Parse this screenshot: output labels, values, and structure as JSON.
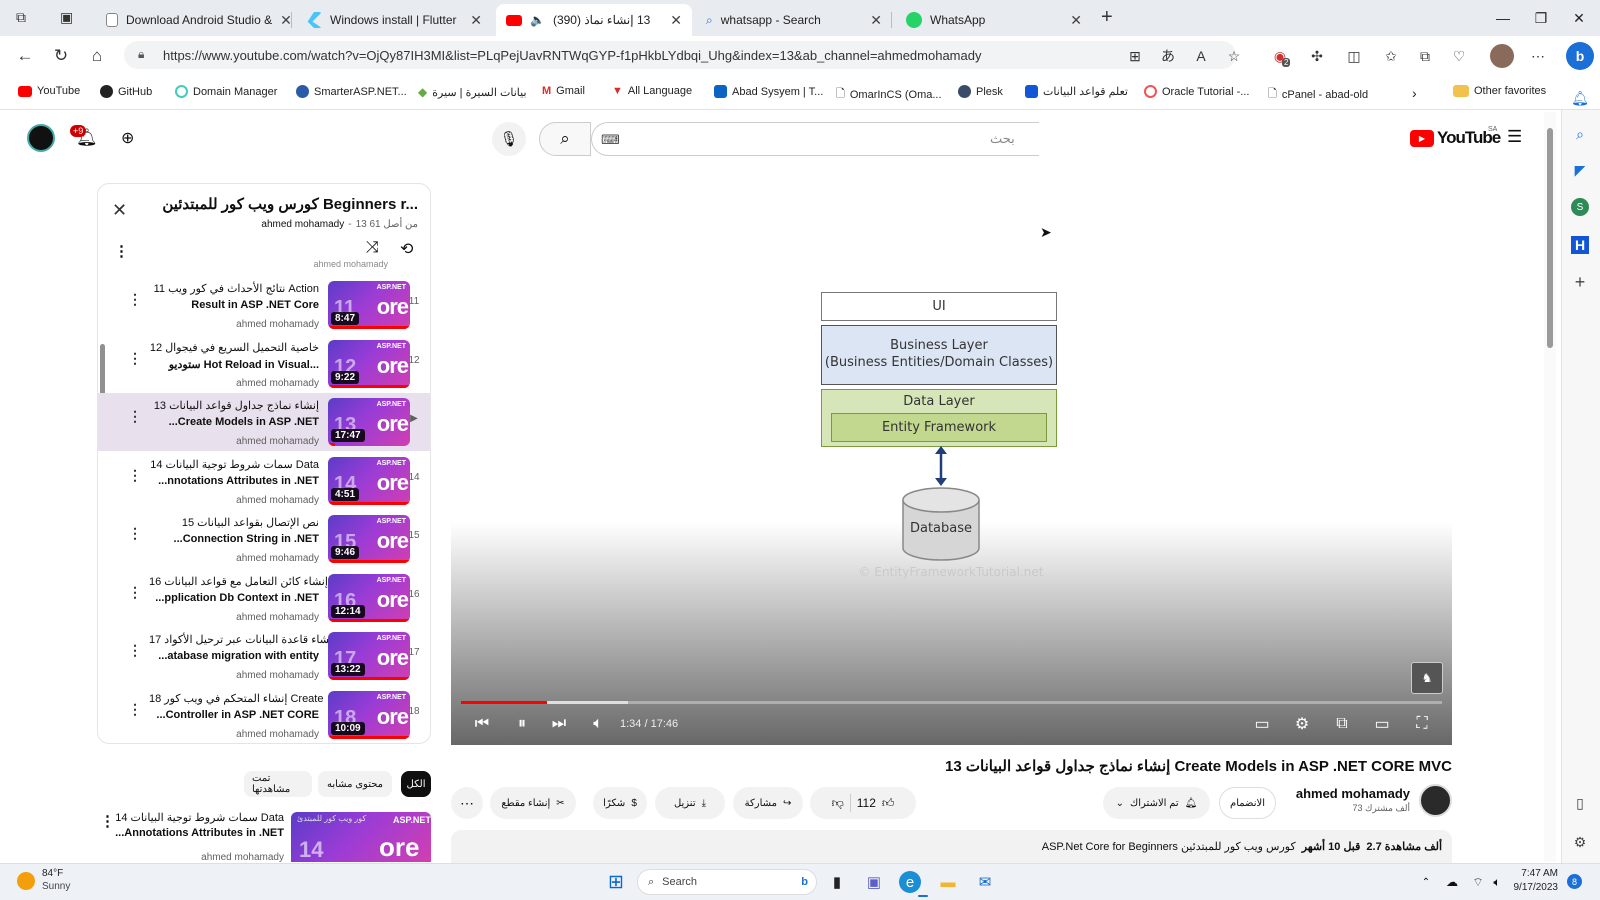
{
  "browser": {
    "tabs": [
      {
        "title": "Download Android Studio &",
        "favicon_color": "#7a7a7a"
      },
      {
        "title": "Windows install | Flutter",
        "favicon_color": "#47c5fb"
      },
      {
        "title": "13 إنشاء نماذ (390)",
        "favicon_color": "#ff0000",
        "active": true
      },
      {
        "title": "whatsapp - Search",
        "favicon_color": "#1a73e8"
      },
      {
        "title": "WhatsApp",
        "favicon_color": "#25d366"
      }
    ],
    "url": "https://www.youtube.com/watch?v=OjQy87IH3MI&list=PLqPejUavRNTWqGYP-f1pHkbLYdbqi_Uhg&index=13&ab_channel=ahmedmohamady",
    "favorites": [
      "YouTube",
      "GitHub",
      "Domain Manager",
      "SmarterASP.NET...",
      "بيانات السيرة | سيرة",
      "Gmail",
      "All Language",
      "Abad Sysyem | T...",
      "OmarInCS (Oma...",
      "Plesk",
      "تعلم قواعد البيانات",
      "Oracle Tutorial -...",
      "cPanel - abad-old"
    ],
    "other_favorites": "Other favorites",
    "ext_badge": "2"
  },
  "youtube": {
    "logo": "YouTube",
    "region": "SA",
    "search_placeholder": "بحث",
    "notif_count": "+9"
  },
  "playlist": {
    "title": "كورس ويب كور للمبتدئين Beginners r...",
    "owner": "ahmed mohamady",
    "position": "13 من أصل 61",
    "items": [
      {
        "idx": "11",
        "line1": "11 نتائج الأحداث في كور ويب Action",
        "line2": "Result in ASP .NET Core",
        "channel": "ahmed mohamady",
        "duration": "8:47",
        "num": "11"
      },
      {
        "idx": "12",
        "line1": "12 خاصية التحميل السريع في فيجوال",
        "line2": "ستوديو Hot Reload in Visual...",
        "channel": "ahmed mohamady",
        "duration": "9:22",
        "num": "12"
      },
      {
        "idx": "▶",
        "line1": "13 إنشاء نماذج جداول قواعد البيانات",
        "line2": "...Create Models in ASP .NET",
        "channel": "ahmed mohamady",
        "duration": "17:47",
        "num": "13"
      },
      {
        "idx": "14",
        "line1": "14 سمات شروط توجية البيانات Data",
        "line2": "...nnotations Attributes in .NET",
        "channel": "ahmed mohamady",
        "duration": "4:51",
        "num": "14"
      },
      {
        "idx": "15",
        "line1": "15 نص الإتصال بقواعد البيانات",
        "line2": "...Connection String in .NET",
        "channel": "ahmed mohamady",
        "duration": "9:46",
        "num": "15"
      },
      {
        "idx": "16",
        "line1": "16 إنشاء كائن التعامل مع قواعد البيانات",
        "line2": "...pplication Db Context in .NET",
        "channel": "ahmed mohamady",
        "duration": "12:14",
        "num": "16"
      },
      {
        "idx": "17",
        "line1": "17 إنشاء قاعدة البيانات عبر ترحيل الأكواد",
        "line2": "...atabase migration with entity",
        "channel": "ahmed mohamady",
        "duration": "13:22",
        "num": "17"
      },
      {
        "idx": "18",
        "line1": "18 إنشاء المتحكم في ويب كور Create",
        "line2": "...Controller in ASP .NET CORE",
        "channel": "ahmed mohamady",
        "duration": "10:09",
        "num": "18"
      }
    ],
    "partial_top_channel": "ahmed mohamady"
  },
  "chips": [
    "الكل",
    "محتوى مشابه",
    "تمت مشاهدتها"
  ],
  "related": {
    "line1": "14 سمات شروط توجية البيانات Data",
    "line2": "...Annotations Attributes in .NET",
    "channel": "ahmed mohamady",
    "thumb_text": "ASP.NET",
    "thumb_core": "ore",
    "thumb_title": "كور ويب كور للمبتدئ",
    "thumb_num": "14"
  },
  "video": {
    "diagram": {
      "ui": "UI",
      "business": "Business Layer",
      "business_sub": "(Business Entities/Domain Classes)",
      "data": "Data Layer",
      "ef": "Entity Framework",
      "db": "Database",
      "watermark": "© EntityFrameworkTutorial.net"
    },
    "time": "1:34 / 17:46",
    "progress": 0.088,
    "buffered": 0.17,
    "title": "13 إنشاء نماذج جداول قواعد البيانات Create Models in ASP .NET CORE MVC",
    "channel": "ahmed mohamady",
    "subs": "73 ألف مشترك",
    "join": "الانضمام",
    "subscribed": "تم الاشتراك",
    "likes": "112",
    "share": "مشاركة",
    "download": "تنزيل",
    "thanks": "شكرًا",
    "clip": "إنشاء مقطع",
    "views": "2.7 ألف مشاهدة",
    "age": "قبل 10 أشهر",
    "desc": "ASP.Net Core for Beginners  كورس ويب كور للمبتدئين"
  },
  "taskbar": {
    "weather_temp": "84°F",
    "weather_desc": "Sunny",
    "search": "Search",
    "time": "7:47 AM",
    "date": "9/17/2023",
    "notif": "8"
  }
}
